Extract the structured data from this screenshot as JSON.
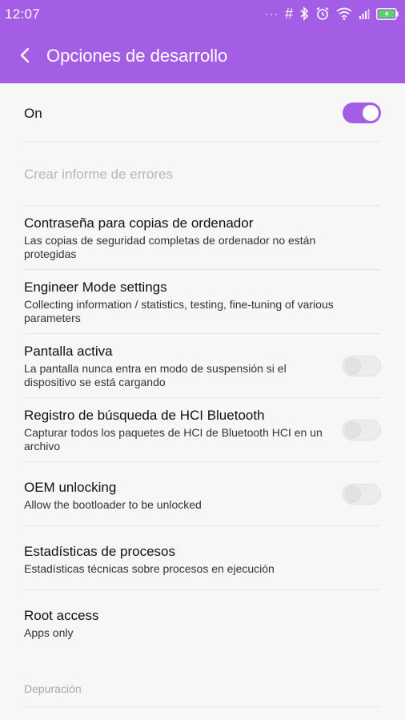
{
  "status_bar": {
    "time": "12:07",
    "overflow": "···",
    "hash": "#"
  },
  "app_bar": {
    "title": "Opciones de desarrollo"
  },
  "colors": {
    "accent": "#a45ee5"
  },
  "master_toggle": {
    "label": "On",
    "checked": true
  },
  "items": [
    {
      "title": "Crear informe de errores",
      "disabled": true
    },
    {
      "title": "Contraseña para copias de ordenador",
      "subtitle": "Las copias de seguridad completas de ordenador no están protegidas"
    },
    {
      "title": "Engineer Mode settings",
      "subtitle": "Collecting information / statistics, testing, fine-tuning of various parameters"
    },
    {
      "title": "Pantalla activa",
      "subtitle": "La pantalla nunca entra en modo de suspensión si el dispositivo se está cargando",
      "checked": false
    },
    {
      "title": "Registro de búsqueda de HCI Bluetooth",
      "subtitle": "Capturar todos los paquetes de HCI de Bluetooth HCI en un archivo",
      "checked": false
    },
    {
      "title": "OEM unlocking",
      "subtitle": "Allow the bootloader to be unlocked",
      "checked": false
    },
    {
      "title": "Estadísticas de procesos",
      "subtitle": "Estadísticas técnicas sobre procesos en ejecución"
    },
    {
      "title": "Root access",
      "subtitle": "Apps only"
    }
  ],
  "section_header": "Depuración",
  "icons": [
    "back-arrow-icon",
    "hash-icon",
    "bluetooth-icon",
    "alarm-icon",
    "wifi-icon",
    "signal-icon",
    "battery-charging-icon"
  ]
}
